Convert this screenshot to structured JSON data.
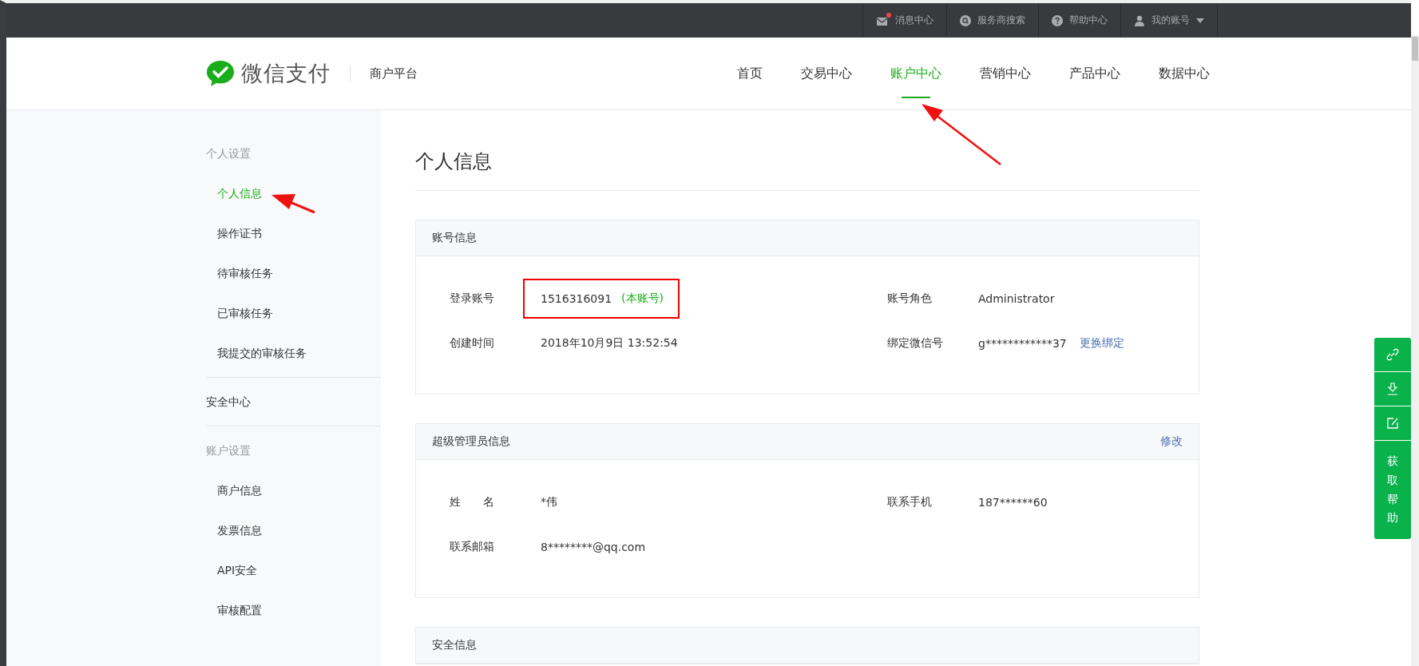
{
  "top_bar": {
    "items": [
      {
        "kind": "messages",
        "label": "消息中心",
        "unread": true
      },
      {
        "kind": "search",
        "label": "服务商搜索"
      },
      {
        "kind": "help",
        "label": "帮助中心"
      },
      {
        "kind": "account",
        "label": "我的账号"
      }
    ]
  },
  "header": {
    "brand": "微信支付",
    "platform": "商户平台",
    "nav": [
      {
        "label": "首页",
        "selected": false
      },
      {
        "label": "交易中心",
        "selected": false
      },
      {
        "label": "账户中心",
        "selected": true
      },
      {
        "label": "营销中心",
        "selected": false
      },
      {
        "label": "产品中心",
        "selected": false
      },
      {
        "label": "数据中心",
        "selected": false
      }
    ]
  },
  "sidebar": {
    "sections": [
      {
        "kind": "group",
        "title": "个人设置",
        "items": [
          {
            "label": "个人信息",
            "selected": true
          },
          {
            "label": "操作证书",
            "selected": false
          },
          {
            "label": "待审核任务",
            "selected": false
          },
          {
            "label": "已审核任务",
            "selected": false
          },
          {
            "label": "我提交的审核任务",
            "selected": false
          }
        ]
      },
      {
        "kind": "link",
        "label": "安全中心",
        "selected": false
      },
      {
        "kind": "group",
        "title": "账户设置",
        "items": [
          {
            "label": "商户信息",
            "selected": false
          },
          {
            "label": "发票信息",
            "selected": false
          },
          {
            "label": "API安全",
            "selected": false
          },
          {
            "label": "审核配置",
            "selected": false
          }
        ]
      }
    ]
  },
  "page_title": "个人信息",
  "cards": [
    {
      "title": "账号信息",
      "fields": [
        {
          "label": "登录账号",
          "value": "1516316091",
          "note": "(本账号)",
          "highlighted": true
        },
        {
          "label": "账号角色",
          "value": "Administrator"
        },
        {
          "label": "创建时间",
          "value": "2018年10月9日 13:52:54"
        },
        {
          "label": "绑定微信号",
          "value": "g************37",
          "link": "更换绑定"
        }
      ]
    },
    {
      "title": "超级管理员信息",
      "action": "修改",
      "fields": [
        {
          "label": "姓　　名",
          "value": "*伟"
        },
        {
          "label": "联系手机",
          "value": "187******60"
        },
        {
          "label": "联系邮箱",
          "value": "8********@qq.com"
        }
      ]
    },
    {
      "title": "安全信息"
    }
  ],
  "help_float": {
    "items": [
      {
        "kind": "link"
      },
      {
        "kind": "download"
      },
      {
        "kind": "edit"
      },
      {
        "kind": "text",
        "label": "获取帮助"
      }
    ]
  }
}
